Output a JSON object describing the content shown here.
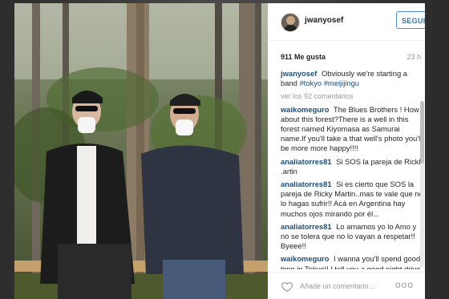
{
  "post": {
    "username": "jwanyosef",
    "follow_label": "SEGUIR",
    "likes": "911 Me gusta",
    "time": "23 h",
    "caption_user": "jwanyosef",
    "caption_text": "Obviously we're starting a band",
    "caption_tags": [
      "#tokyo",
      "#meijijingu"
    ],
    "view_all": "ver los 92 comentarios"
  },
  "comments": [
    {
      "user": "waikomeguro",
      "text": "The Blues Brothers ! How about this forest?There is a well in this forest named Kiyomasa as Samurai name.If you'll take a that well's photo you'll be more more happy!!!!"
    },
    {
      "user": "analiatorres81",
      "text": "Si SOS la pareja de Rickh .artin"
    },
    {
      "user": "analiatorres81",
      "text": "Si es cierto que SOS la pareja de Ricky Martin..mas te vale que no lo hagas sufrir!! Acá en Argentina hay muchos ojos mirando por él..."
    },
    {
      "user": "analiatorres81",
      "text": "Lo amamos yo lo Amo y no se tolera que no lo vayan a respetar!! Byeee!!"
    },
    {
      "user": "waikomeguro",
      "text": "I wanna you'll spend good time in Tokyo!! I tell you a good night drive corse in"
    }
  ],
  "footer": {
    "add_comment_placeholder": "Añade un comentario...",
    "more_label": "ooo"
  },
  "icons": {
    "heart": "heart-icon",
    "more": "ellipsis-icon"
  },
  "colors": {
    "accent": "#3f729b",
    "button_border": "#4d8fd6",
    "muted": "#999999"
  }
}
